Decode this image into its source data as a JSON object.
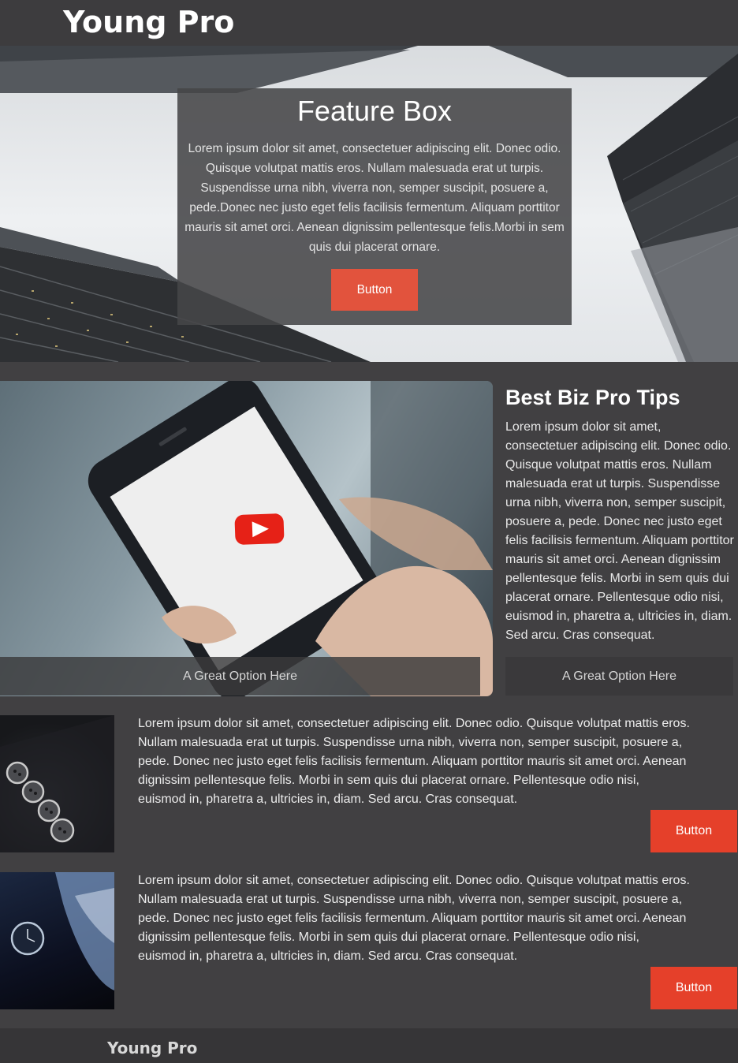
{
  "header": {
    "brand": "Young Pro"
  },
  "hero": {
    "title": "Feature Box",
    "text": "Lorem ipsum dolor sit amet, consectetuer adipiscing elit. Donec odio. Quisque volutpat mattis eros. Nullam malesuada erat ut turpis. Suspendisse urna nibh, viverra non, semper suscipit, posuere a, pede.Donec nec justo eget felis facilisis fermentum. Aliquam porttitor mauris sit amet orci. Aenean dignissim pellentesque felis.Morbi in sem quis dui placerat ornare.",
    "button_label": "Button"
  },
  "media_section": {
    "image_caption": "A Great Option Here",
    "tips_title": "Best Biz Pro Tips",
    "tips_text": "Lorem ipsum dolor sit amet, consectetuer adipiscing elit. Donec odio. Quisque volutpat mattis eros. Nullam malesuada erat ut turpis. Suspendisse urna nibh, viverra non, semper suscipit, posuere a, pede. Donec nec justo eget felis facilisis fermentum. Aliquam porttitor mauris sit amet orci. Aenean dignissim pellentesque felis. Morbi in sem quis dui placerat ornare. Pellentesque odio nisi, euismod in, pharetra a, ultricies in, diam. Sed arcu. Cras consequat.",
    "tips_option": "A Great Option Here"
  },
  "rows": [
    {
      "text": "Lorem ipsum dolor sit amet, consectetuer adipiscing elit. Donec odio. Quisque volutpat mattis eros. Nullam malesuada erat ut turpis. Suspendisse urna nibh, viverra non, semper suscipit, posuere a, pede. Donec nec justo eget felis facilisis fermentum. Aliquam porttitor mauris sit amet orci. Aenean dignissim pellentesque felis. Morbi in sem quis dui placerat ornare. Pellentesque odio nisi, euismod in, pharetra a, ultricies in, diam. Sed arcu. Cras consequat.",
      "button_label": "Button"
    },
    {
      "text": "Lorem ipsum dolor sit amet, consectetuer adipiscing elit. Donec odio. Quisque volutpat mattis eros. Nullam malesuada erat ut turpis. Suspendisse urna nibh, viverra non, semper suscipit, posuere a, pede. Donec nec justo eget felis facilisis fermentum. Aliquam porttitor mauris sit amet orci. Aenean dignissim pellentesque felis. Morbi in sem quis dui placerat ornare. Pellentesque odio nisi, euismod in, pharetra a, ultricies in, diam. Sed arcu. Cras consequat.",
      "button_label": "Button"
    }
  ],
  "footer": {
    "brand": "Young Pro"
  },
  "colors": {
    "background": "#414042",
    "accent_button": "#e5402a",
    "hero_button": "#e2533d",
    "youtube_red": "#e62117"
  },
  "icons": [
    "youtube-play-icon"
  ]
}
